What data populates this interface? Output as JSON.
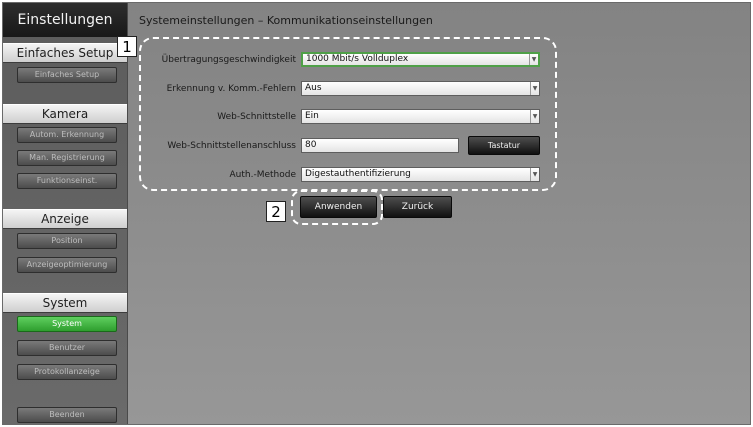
{
  "app_title": "Einstellungen",
  "sidebar": {
    "sections": [
      {
        "header": "Einfaches Setup",
        "items": [
          {
            "label": "Einfaches Setup",
            "active": false
          }
        ]
      },
      {
        "header": "Kamera",
        "items": [
          {
            "label": "Autom. Erkennung",
            "active": false
          },
          {
            "label": "Man. Registrierung",
            "active": false
          },
          {
            "label": "Funktionseinst.",
            "active": false
          }
        ]
      },
      {
        "header": "Anzeige",
        "items": [
          {
            "label": "Position",
            "active": false
          },
          {
            "label": "Anzeigeoptimierung",
            "active": false
          }
        ]
      },
      {
        "header": "System",
        "items": [
          {
            "label": "System",
            "active": true
          },
          {
            "label": "Benutzer",
            "active": false
          },
          {
            "label": "Protokollanzeige",
            "active": false
          }
        ]
      }
    ],
    "exit_label": "Beenden"
  },
  "main": {
    "title": "Systemeinstellungen – Kommunikationseinstellungen",
    "fields": {
      "speed": {
        "label": "Übertragungsgeschwindigkeit",
        "value": "1000 Mbit/s Vollduplex"
      },
      "comm_error": {
        "label": "Erkennung v. Komm.-Fehlern",
        "value": "Aus"
      },
      "web_if": {
        "label": "Web-Schnittstelle",
        "value": "Ein"
      },
      "web_port": {
        "label": "Web-Schnittstellenanschluss",
        "value": "80"
      },
      "auth": {
        "label": "Auth.-Methode",
        "value": "Digestauthentifizierung"
      }
    },
    "keyboard_button": "Tastatur",
    "apply_button": "Anwenden",
    "back_button": "Zurück"
  },
  "callouts": {
    "first": "1",
    "second": "2"
  },
  "colors": {
    "active_green": "#3db33d",
    "focus_border": "#4fa048"
  }
}
